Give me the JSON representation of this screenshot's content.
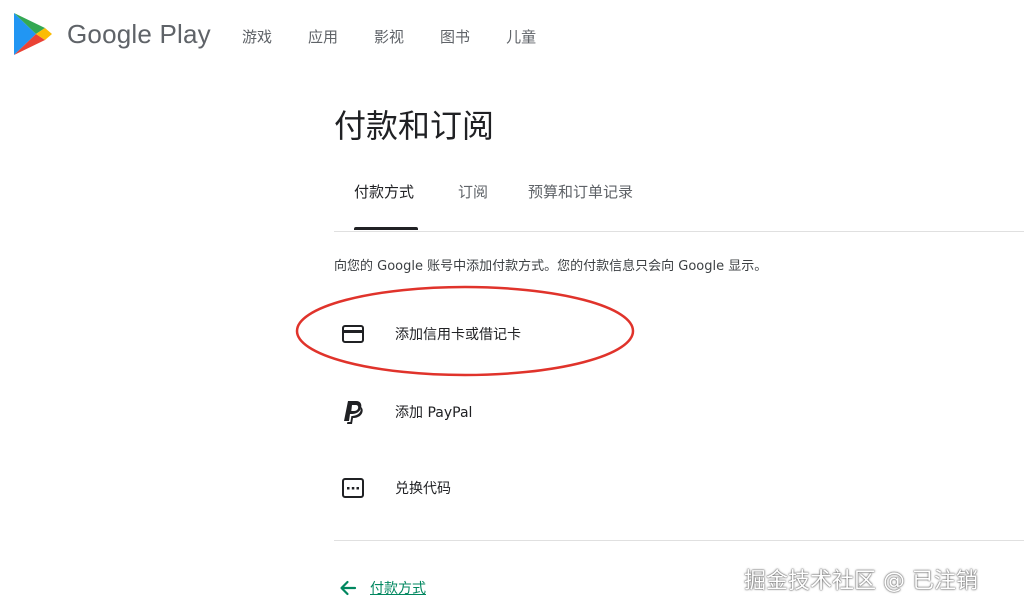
{
  "app": {
    "logo_text": "Google Play"
  },
  "nav": [
    "游戏",
    "应用",
    "影视",
    "图书",
    "儿童"
  ],
  "page": {
    "title": "付款和订阅"
  },
  "tabs": [
    "付款方式",
    "订阅",
    "预算和订单记录"
  ],
  "active_tab": "付款方式",
  "info_text": "向您的 Google 账号中添加付款方式。您的付款信息只会向 Google 显示。",
  "methods": [
    {
      "label": "添加信用卡或借记卡",
      "icon": "credit-card-icon"
    },
    {
      "label": "添加 PayPal",
      "icon": "paypal-icon"
    },
    {
      "label": "兑换代码",
      "icon": "redeem-code-icon"
    }
  ],
  "back_link": {
    "label": "付款方式",
    "icon": "arrow-left-icon"
  },
  "watermark": "掘金技术社区 @ 已注销",
  "colors": {
    "accent": "#01875f",
    "highlight_ring": "#e0332b"
  }
}
